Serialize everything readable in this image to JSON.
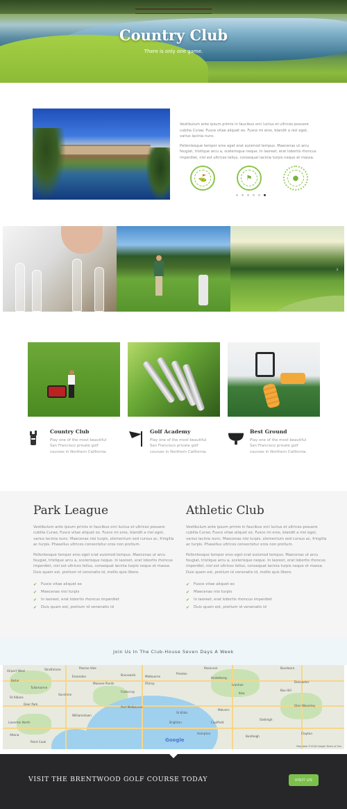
{
  "hero": {
    "title": "Country Club",
    "subtitle": "There is only one game."
  },
  "intro": {
    "paragraphs": [
      "Vestibulum ante ipsum primis in faucibus orci luctus et ultrices posuere cubilia Curae; Fusce vitae aliquet ex. Fusce mi eros, blandit a nisl eget, varius lacinia nunc.",
      "Pellentesque tempor eros eget erat euismod tempus. Maecenas ut arcu feugiat, tristique arcu a, scelerisque neque. In laoreet, erat lobortis rhoncus imperdiet, nisl est ultrices tellus, consequat lacinia turpis neque et massa."
    ],
    "badges": [
      "golf-badge-icon",
      "golf-flag-badge-icon",
      "golf-ball-badge-icon"
    ],
    "carousel": {
      "dot_count": 6,
      "active_index": 5
    }
  },
  "features": [
    {
      "title": "Country Club",
      "desc": "Play one of the most beautiful San Francisco private golf courses in Northern California.",
      "icon": "golf-bag-icon"
    },
    {
      "title": "Golf Academy",
      "desc": "Play one of the most beautiful San Francisco private golf courses in Northern California.",
      "icon": "golf-flag-icon"
    },
    {
      "title": "Best Ground",
      "desc": "Play one of the most beautiful San Francisco private golf courses in Northern California.",
      "icon": "golf-ball-tee-icon"
    }
  ],
  "clubs": [
    {
      "title": "Park League",
      "paragraphs": [
        "Vestibulum ante ipsum primis in faucibus orci luctus et ultrices posuere cubilia Curae; Fusce vitae aliquet ex. Fusce mi eros, blandit a nisl eget, varius lacinia nunc. Maecenas nisi turpis, elementum sed cursus ac, fringilla ac turpis. Phasellus ultrices consectetur eros non pretium.",
        "Pellentesque tempor eros eget erat euismod tempus. Maecenas ut arcu feugiat, tristique arcu a, scelerisque neque. In laoreet, erat lobortis rhoncus imperdiet, nisl est ultrices tellus, consequat lacinia turpis neque et massa. Duis quam est, pretium id venenatis id, mollis quis libero."
      ],
      "list": [
        "Fusce vitae aliquet ex",
        "Maecenas nisi turpis",
        "In laoreet, erat lobortis rhoncus imperdiet",
        "Duis quam est, pretium id venenatis id"
      ]
    },
    {
      "title": "Athletic Club",
      "paragraphs": [
        "Vestibulum ante ipsum primis in faucibus orci luctus et ultrices posuere cubilia Curae; Fusce vitae aliquet ex. Fusce mi eros, blandit a nisl eget, varius lacinia nunc. Maecenas nisi turpis, elementum sed cursus ac, fringilla ac turpis. Phasellus ultrices consectetur eros non pretium.",
        "Pellentesque tempor eros eget erat euismod tempus. Maecenas ut arcu feugiat, tristique arcu a, scelerisque neque. In laoreet, erat lobortis rhoncus imperdiet, nisl est ultrices tellus, consequat lacinia turpis neque et massa. Duis quam est, pretium id venenatis id, mollis quis libero."
      ],
      "list": [
        "Fusce vitae aliquet ex",
        "Maecenas nisi turpis",
        "In laoreet, erat lobortis rhoncus imperdiet",
        "Duis quam est, pretium id venenatis id"
      ]
    }
  ],
  "join": {
    "text": "Join Us In The Club-House Seven Days A Week"
  },
  "map": {
    "labels": [
      "Airport West",
      "Strathmore",
      "Pascoe Vale",
      "Reservoir",
      "Bundoora",
      "Keilor",
      "Essendon",
      "Brunswick",
      "Preston",
      "Heidelberg",
      "Tullamarine",
      "Moonee Ponds",
      "Fitzroy",
      "Ivanhoe",
      "Doncaster",
      "St Albans",
      "Sunshine",
      "Footscray",
      "Melbourne",
      "Kew",
      "Box Hill",
      "Deer Park",
      "Altona",
      "Williamstown",
      "Port Melbourne",
      "St Kilda",
      "Malvern",
      "Glen Waverley",
      "Laverton North",
      "Brighton",
      "Caulfield",
      "Oakleigh",
      "Point Cook",
      "Hampton",
      "Bentleigh",
      "Clayton"
    ],
    "attribution": "Google",
    "credit": "Map data ©2018 Google   Terms of Use"
  },
  "footer": {
    "cta": "VISIT THE BRENTWOOD GOLF COURSE TODAY",
    "button": "VISIT US"
  },
  "colors": {
    "accent": "#7cc04b",
    "footer_bg": "#27272a",
    "section_bg": "#f5f5f5",
    "join_bg": "#eef6fa"
  }
}
